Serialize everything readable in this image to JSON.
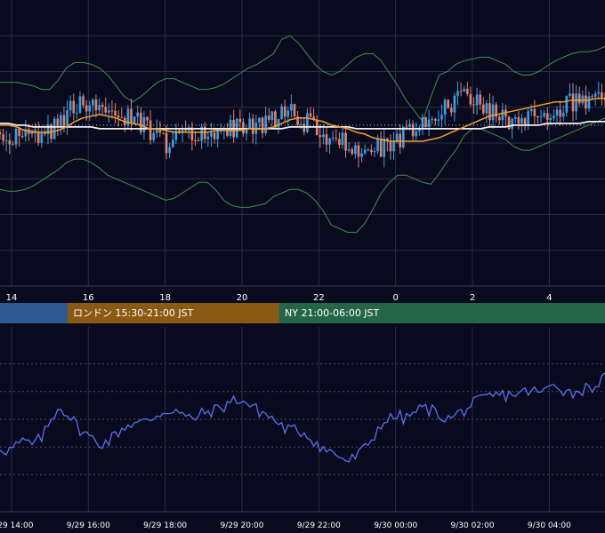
{
  "colors": {
    "background": "#0a0a1e",
    "grid": "#2a2d44",
    "candle_up": "#3aa0e6",
    "candle_down": "#e0836e",
    "bollinger": "#3f8f5a",
    "ma_short": "#f0a030",
    "ma_long": "#f0f0f0",
    "reference_line": "#c8c8c8",
    "oscillator": "#5a6ff0",
    "axis_text": "#ffffff"
  },
  "sessions": {
    "tokyo": "",
    "london": "ロンドン 15:30-21:00 JST",
    "ny": "NY 21:00-06:00 JST"
  },
  "chart_data": [
    {
      "type": "candlestick",
      "title": "",
      "x_ticks": [
        "14",
        "16",
        "18",
        "20",
        "22",
        "0",
        "2",
        "4"
      ],
      "x_tick_hours": [
        14,
        16,
        18,
        20,
        22,
        24,
        26,
        28
      ],
      "x_range_hours": [
        13.7,
        29.45
      ],
      "reference_level": 50,
      "seed": 20240929,
      "series": [
        {
          "name": "",
          "kind": "close",
          "values": [
            46,
            45,
            44,
            44,
            45,
            46,
            47,
            49,
            56,
            61,
            64,
            62,
            62,
            60,
            58,
            56,
            53,
            50,
            47,
            43,
            40,
            42,
            44,
            46,
            46,
            47,
            48,
            48,
            49,
            49,
            50,
            50,
            51,
            53,
            56,
            57,
            54,
            51,
            48,
            45,
            43,
            41,
            38,
            35,
            35,
            36,
            38,
            39,
            42,
            44,
            47,
            50,
            53,
            55,
            60,
            64,
            66,
            66,
            62,
            58,
            55,
            52,
            52,
            53,
            55,
            56,
            58,
            60,
            61,
            62,
            63,
            64,
            64,
            65
          ]
        },
        {
          "name": "",
          "kind": "bollinger_upper",
          "values": [
            74,
            74,
            74,
            73,
            72,
            70,
            70,
            75,
            82,
            85,
            85,
            84,
            82,
            78,
            72,
            66,
            63,
            66,
            70,
            74,
            76,
            76,
            74,
            72,
            70,
            70,
            71,
            73,
            76,
            79,
            82,
            84,
            87,
            90,
            98,
            100,
            96,
            90,
            84,
            80,
            78,
            80,
            84,
            88,
            90,
            90,
            86,
            79,
            72,
            64,
            58,
            52,
            66,
            78,
            80,
            84,
            86,
            87,
            88,
            88,
            86,
            84,
            80,
            78,
            78,
            80,
            83,
            86,
            88,
            90,
            91,
            91,
            92,
            94
          ]
        },
        {
          "name": "",
          "kind": "bollinger_lower",
          "values": [
            14,
            13,
            13,
            14,
            16,
            19,
            22,
            25,
            29,
            31,
            31,
            29,
            26,
            22,
            20,
            18,
            16,
            14,
            12,
            10,
            8,
            9,
            12,
            15,
            18,
            18,
            14,
            8,
            5,
            4,
            4,
            5,
            6,
            10,
            12,
            14,
            14,
            12,
            8,
            2,
            -6,
            -8,
            -10,
            -10,
            -5,
            3,
            12,
            18,
            22,
            22,
            20,
            18,
            17,
            23,
            30,
            36,
            44,
            48,
            48,
            46,
            44,
            42,
            38,
            36,
            36,
            38,
            40,
            42,
            44,
            46,
            48,
            50,
            52,
            54
          ]
        },
        {
          "name": "",
          "kind": "ma_short",
          "values": [
            50,
            50,
            49,
            47,
            46,
            46,
            46,
            47,
            49,
            52,
            54,
            55,
            56,
            55,
            54,
            52,
            51,
            50,
            48,
            48,
            47,
            46,
            46,
            46,
            46,
            46,
            47,
            47,
            47,
            47,
            48,
            48,
            48,
            49,
            51,
            53,
            54,
            54,
            53,
            52,
            50,
            49,
            48,
            46,
            45,
            43,
            42,
            41,
            41,
            41,
            41,
            41,
            42,
            43,
            45,
            47,
            49,
            51,
            53,
            55,
            56,
            57,
            58,
            59,
            60,
            61,
            62,
            63,
            63,
            64,
            64,
            64,
            65,
            65
          ]
        },
        {
          "name": "",
          "kind": "ma_long",
          "values": [
            51,
            51,
            50,
            50,
            49,
            49,
            49,
            49,
            49,
            49,
            49,
            49,
            48,
            48,
            48,
            48,
            48,
            48,
            48,
            48,
            48,
            48,
            48,
            48,
            48,
            48,
            48,
            48,
            48,
            48,
            48,
            48,
            48,
            48,
            48,
            49,
            49,
            49,
            49,
            49,
            49,
            49,
            49,
            48,
            48,
            48,
            48,
            48,
            48,
            48,
            48,
            48,
            48,
            48,
            48,
            48,
            48,
            48,
            48,
            49,
            49,
            49,
            50,
            50,
            50,
            50,
            51,
            51,
            51,
            51,
            51,
            52,
            52,
            52
          ]
        }
      ],
      "ylim": [
        -40,
        120
      ]
    },
    {
      "type": "line",
      "title": "",
      "x_ticks": [
        "9/29 14:00",
        "9/29 16:00",
        "9/29 18:00",
        "9/29 20:00",
        "9/29 22:00",
        "9/30 00:00",
        "9/30 02:00",
        "9/30 04:00"
      ],
      "x_tick_hours": [
        14,
        16,
        18,
        20,
        22,
        24,
        26,
        28
      ],
      "x_range_hours": [
        13.7,
        29.45
      ],
      "y_gridlines": [
        80,
        65,
        50,
        35,
        20
      ],
      "ylim": [
        0,
        100
      ],
      "series": [
        {
          "name": "",
          "values": [
            35,
            33,
            36,
            38,
            36,
            40,
            48,
            57,
            54,
            48,
            43,
            40,
            37,
            38,
            42,
            46,
            48,
            48,
            49,
            53,
            54,
            56,
            52,
            50,
            52,
            54,
            55,
            57,
            60,
            61,
            58,
            55,
            53,
            50,
            46,
            44,
            44,
            42,
            38,
            34,
            32,
            30,
            27,
            30,
            34,
            40,
            48,
            50,
            52,
            50,
            54,
            56,
            55,
            53,
            50,
            52,
            55,
            58,
            60,
            62,
            63,
            63,
            64,
            64,
            66,
            64,
            66,
            70,
            66,
            64,
            66,
            67,
            69,
            72
          ]
        }
      ]
    }
  ]
}
